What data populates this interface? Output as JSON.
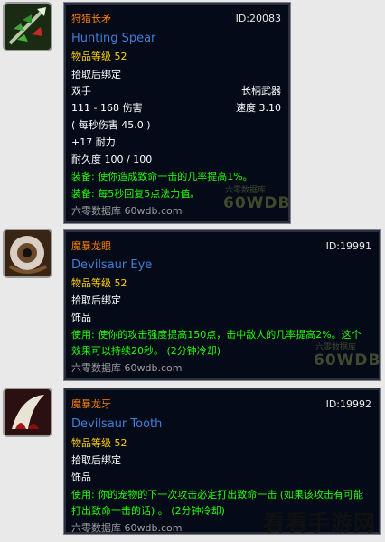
{
  "items": [
    {
      "name_cn": "狩猎长矛",
      "name_en": "Hunting Spear",
      "id": "ID:20083",
      "item_level": "物品等级 52",
      "bind": "拾取后绑定",
      "hand": "双手",
      "type": "长柄武器",
      "damage": "111 - 168 伤害",
      "speed": "速度 3.10",
      "dps": "( 每秒伤害 45.0 )",
      "stat": "+17 耐力",
      "durability": "耐久度 100 / 100",
      "equip1": "装备: 使你造成致命一击的几率提高1%。",
      "equip2": "装备: 每5秒回复5点法力值。",
      "source": "六零数据库 60wdb.com",
      "wm_small": "六零数据库",
      "wm_big": "60WDB",
      "icon": "spear-icon"
    },
    {
      "name_cn": "魔暴龙眼",
      "name_en": "Devilsaur Eye",
      "id": "ID:19991",
      "item_level": "物品等级 52",
      "bind": "拾取后绑定",
      "slot": "饰品",
      "use1": "使用: 使你的攻击强度提高150点，击中敌人的几率提高2%。这个",
      "use2": "效果可以持续20秒。 (2分钟冷却)",
      "source": "六零数据库 60wdb.com",
      "wm_small": "六零数据库",
      "wm_big": "60WDB",
      "icon": "eye-icon"
    },
    {
      "name_cn": "魔暴龙牙",
      "name_en": "Devilsaur Tooth",
      "id": "ID:19992",
      "item_level": "物品等级 52",
      "bind": "拾取后绑定",
      "slot": "饰品",
      "use1": "使用: 你的宠物的下一次攻击必定打出致命一击 (如果该攻击有可能",
      "use2": "打出致命一击的话) 。 (2分钟冷却)",
      "source": "六零数据库 60wdb.com",
      "icon": "tooth-icon"
    }
  ],
  "footer_watermark": "看看手游网"
}
